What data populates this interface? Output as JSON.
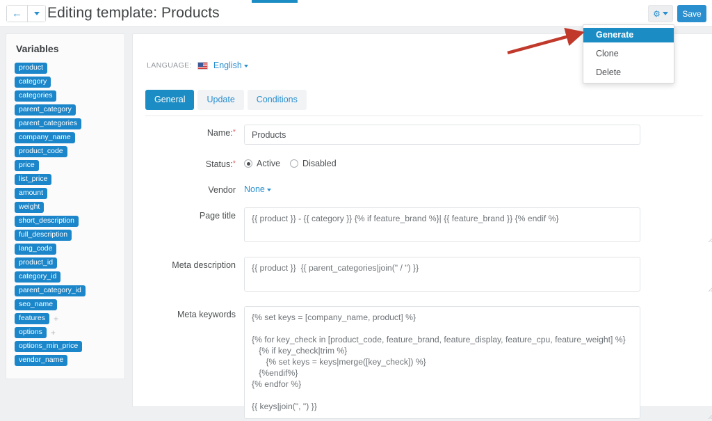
{
  "topbar": {
    "back_icon": "back-arrow-icon",
    "dropdown_caret_icon": "chevron-down-icon",
    "title": "Editing template: Products",
    "gear_icon": "gear-icon",
    "save_label": "Save"
  },
  "actions_menu": {
    "items": [
      {
        "label": "Generate",
        "active": true
      },
      {
        "label": "Clone",
        "active": false
      },
      {
        "label": "Delete",
        "active": false
      }
    ]
  },
  "annotation": {
    "type": "arrow",
    "color": "#c0392b"
  },
  "sidebar": {
    "title": "Variables",
    "variables": [
      {
        "name": "product",
        "add": false
      },
      {
        "name": "category",
        "add": false
      },
      {
        "name": "categories",
        "add": false
      },
      {
        "name": "parent_category",
        "add": false
      },
      {
        "name": "parent_categories",
        "add": false
      },
      {
        "name": "company_name",
        "add": false
      },
      {
        "name": "product_code",
        "add": false
      },
      {
        "name": "price",
        "add": false
      },
      {
        "name": "list_price",
        "add": false
      },
      {
        "name": "amount",
        "add": false
      },
      {
        "name": "weight",
        "add": false
      },
      {
        "name": "short_description",
        "add": false
      },
      {
        "name": "full_description",
        "add": false
      },
      {
        "name": "lang_code",
        "add": false
      },
      {
        "name": "product_id",
        "add": false
      },
      {
        "name": "category_id",
        "add": false
      },
      {
        "name": "parent_category_id",
        "add": false
      },
      {
        "name": "seo_name",
        "add": false
      },
      {
        "name": "features",
        "add": true
      },
      {
        "name": "options",
        "add": true
      },
      {
        "name": "options_min_price",
        "add": false
      },
      {
        "name": "vendor_name",
        "add": false
      }
    ],
    "add_symbol": "+"
  },
  "content": {
    "language_label": "LANGUAGE:",
    "language_value": "English",
    "flag_icon": "us-flag-icon",
    "tabs": [
      {
        "label": "General",
        "active": true
      },
      {
        "label": "Update",
        "active": false
      },
      {
        "label": "Conditions",
        "active": false
      }
    ],
    "fields": {
      "name": {
        "label": "Name:",
        "required": "*",
        "value": "Products"
      },
      "status": {
        "label": "Status:",
        "required": "*",
        "options": [
          {
            "label": "Active",
            "selected": true
          },
          {
            "label": "Disabled",
            "selected": false
          }
        ]
      },
      "vendor": {
        "label": "Vendor",
        "value": "None"
      },
      "page_title": {
        "label": "Page title",
        "value": "{{ product }} - {{ category }} {% if feature_brand %}| {{ feature_brand }} {% endif %}"
      },
      "meta_description": {
        "label": "Meta description",
        "value": "{{ product }}  {{ parent_categories|join(\" / \") }}"
      },
      "meta_keywords": {
        "label": "Meta keywords",
        "value": "{% set keys = [company_name, product] %}\n\n{% for key_check in [product_code, feature_brand, feature_display, feature_cpu, feature_weight] %}\n   {% if key_check|trim %}\n      {% set keys = keys|merge([key_check]) %}\n   {%endif%}\n{% endfor %}\n\n{{ keys|join(\", \") }}"
      }
    }
  },
  "colors": {
    "accent": "#1b8cc4",
    "link": "#2a8fce",
    "tag": "#1b86c9",
    "annotation": "#c0392b"
  }
}
